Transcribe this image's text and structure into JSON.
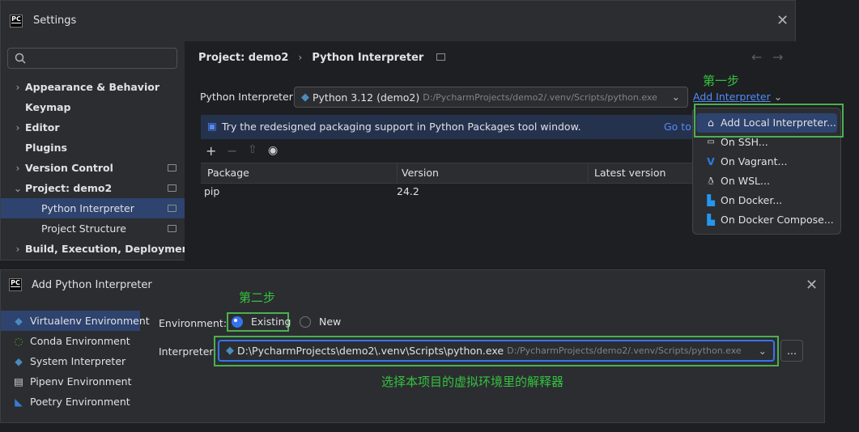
{
  "settings": {
    "title": "Settings",
    "search_placeholder": "",
    "tree": [
      {
        "label": "Appearance & Behavior",
        "chevron": "›",
        "level": 0
      },
      {
        "label": "Keymap",
        "chevron": "",
        "level": 0
      },
      {
        "label": "Editor",
        "chevron": "›",
        "level": 0
      },
      {
        "label": "Plugins",
        "chevron": "",
        "level": 0
      },
      {
        "label": "Version Control",
        "chevron": "›",
        "level": 0
      },
      {
        "label": "Project: demo2",
        "chevron": "⌄",
        "level": 0
      },
      {
        "label": "Python Interpreter",
        "chevron": "",
        "level": 1
      },
      {
        "label": "Project Structure",
        "chevron": "",
        "level": 1
      },
      {
        "label": "Build, Execution, Deployment",
        "chevron": "›",
        "level": 0
      }
    ],
    "breadcrumb": {
      "project": "Project: demo2",
      "separator": "›",
      "page": "Python Interpreter"
    },
    "interpreter_label": "Python Interpreter:",
    "interpreter_name": "Python 3.12 (demo2)",
    "interpreter_path": "D:/PycharmProjects/demo2/.venv/Scripts/python.exe",
    "add_interpreter_link": "Add Interpreter",
    "step1": "第一步",
    "banner_text": "Try the redesigned packaging support in Python Packages tool window.",
    "banner_link": "Go to",
    "table": {
      "columns": [
        "Package",
        "Version",
        "Latest version"
      ],
      "rows": [
        {
          "package": "pip",
          "version": "24.2",
          "latest": ""
        }
      ]
    }
  },
  "popup": {
    "items": [
      {
        "label": "Add Local Interpreter...",
        "icon": "home-icon"
      },
      {
        "label": "On SSH...",
        "icon": "terminal-icon"
      },
      {
        "label": "On Vagrant...",
        "icon": "vagrant-icon"
      },
      {
        "label": "On WSL...",
        "icon": "linux-icon"
      },
      {
        "label": "On Docker...",
        "icon": "docker-icon"
      },
      {
        "label": "On Docker Compose...",
        "icon": "docker-compose-icon"
      }
    ]
  },
  "add_dialog": {
    "title": "Add Python Interpreter",
    "environments": [
      {
        "label": "Virtualenv Environment",
        "icon": "python-icon"
      },
      {
        "label": "Conda Environment",
        "icon": "conda-icon"
      },
      {
        "label": "System Interpreter",
        "icon": "python-icon"
      },
      {
        "label": "Pipenv Environment",
        "icon": "pipenv-icon"
      },
      {
        "label": "Poetry Environment",
        "icon": "poetry-icon"
      }
    ],
    "environment_label": "Environment:",
    "option_existing": "Existing",
    "option_new": "New",
    "interpreter_label": "Interpreter:",
    "interpreter_value": "D:\\PycharmProjects\\demo2\\.venv\\Scripts\\python.exe",
    "interpreter_hint": "D:/PycharmProjects/demo2/.venv/Scripts/python.exe",
    "browse_label": "...",
    "step2": "第二步",
    "annotation": "选择本项目的虚拟环境里的解释器"
  },
  "colors": {
    "accent": "#548af7",
    "selected": "#2e436e",
    "annotation_green": "#35c13f",
    "highlight_box": "#4caf50"
  }
}
